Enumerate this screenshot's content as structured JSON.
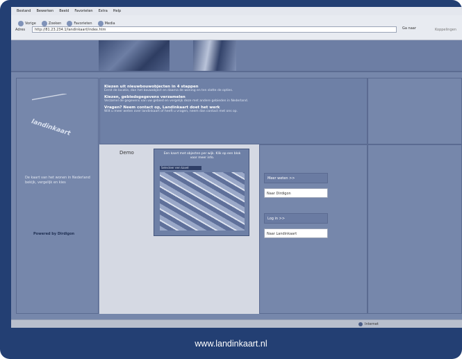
{
  "menu": {
    "items": [
      "Bestand",
      "Bewerken",
      "Beeld",
      "Favorieten",
      "Extra",
      "Help"
    ]
  },
  "toolbar": {
    "back_label": "Vorige",
    "search_label": "Zoeken",
    "favorites_label": "Favorieten",
    "media_label": "Media"
  },
  "address": {
    "label": "Adres",
    "value": "http://81.23.234.1/landinkaart/index.htm",
    "go_label": "Ga naar",
    "links_label": "Koppelingen"
  },
  "sidebar": {
    "logo_text": "landinkaart",
    "tagline": "De kaart van het wonen in Nederland bekijk, vergelijk en kies",
    "powered_by": "Powered by Dirdigon"
  },
  "info": {
    "blocks": [
      {
        "title": "Kiezen uit nieuwbouwobjecten in 4 stappen",
        "text": "Eerst de locatie, dan het bouwobject en daarna de woning en ten slotte de opties."
      },
      {
        "title": "Kiezen, gebiedsgegevens verzamelen",
        "text": "Verzamel de gegevens van uw gebied en vergelijk deze met andere gebieden in Nederland."
      },
      {
        "title": "Vragen? Neem contact op, Landinkaart doet het werk",
        "text": "Wilt u meer weten over landinkaart of heeft u vragen, neem dan contact met ons op."
      }
    ]
  },
  "demo": {
    "title": "Demo",
    "map_caption": "Een kaart met objecten per wijk. Klik op een blok voor meer info.",
    "map_bar": "Selecteer een kavel"
  },
  "panels": {
    "more_info_label": "Meer weten >>",
    "more_info_button": "Naar Dirdigon",
    "login_label": "Log in >>",
    "login_button": "Naar Landinkaart"
  },
  "statusbar": {
    "zone": "Internet"
  },
  "footer": {
    "url": "www.landinkaart.nl"
  },
  "colors": {
    "frame": "#233f73",
    "site_bg": "#7687ab",
    "content_bg": "#d5d9e3"
  }
}
